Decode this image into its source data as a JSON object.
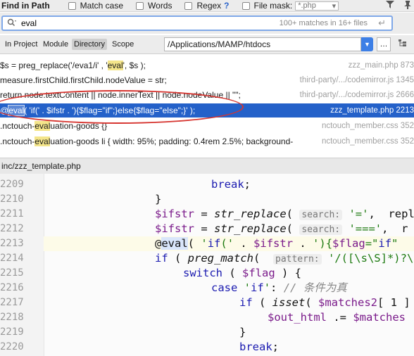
{
  "topbar": {
    "title": "Find in Path",
    "match_case": "Match case",
    "words": "Words",
    "regex": "Regex",
    "regex_help": "?",
    "file_mask_label": "File mask:",
    "file_mask_value": "*.php"
  },
  "search": {
    "query": "eval",
    "matches": "100+ matches in 16+ files"
  },
  "scope": {
    "tabs": [
      "In Project",
      "Module",
      "Directory",
      "Scope"
    ],
    "directory": "/Applications/MAMP/htdocs"
  },
  "results": [
    {
      "code": "",
      "file": ""
    },
    {
      "pre": "$s = preg_replace('/eva1/i' , '",
      "match": "eval",
      "post": "', $s );",
      "file": "zzz_main.php 873"
    },
    {
      "pre": "measure.firstChild.firstChild.nodeValue = str;",
      "match": "",
      "post": "",
      "file": "third-party/.../codemirror.js 1345"
    },
    {
      "pre": "return node.textContent || node.innerText || node.nodeVa",
      "match": "",
      "post": "lue || \"\";",
      "file": "third-party/.../codemirror.js 2666"
    },
    {
      "pre": "@",
      "match": "eval",
      "post": "( 'if(' . $ifstr . '){$flag=\"if\";}else{$flag=\"else\";}' );",
      "file": "zzz_template.php 2213"
    },
    {
      "pre": ".nctouch-",
      "match": "eval",
      "post": "uation-goods {}",
      "file": "nctouch_member.css 352"
    },
    {
      "pre": ".nctouch-",
      "match": "eval",
      "post": "uation-goods li { width: 95%; padding: 0.4rem 2.5%; background-",
      "file": "nctouch_member.css 352"
    }
  ],
  "file_header": "inc/zzz_template.php",
  "editor": {
    "lines": [
      {
        "n": "2209",
        "code": "break;"
      },
      {
        "n": "2210",
        "code": "}"
      },
      {
        "n": "2211",
        "code": "$ifstr = str_replace( search: '=',  repl"
      },
      {
        "n": "2212",
        "code": "$ifstr = str_replace( search: '===',  r"
      },
      {
        "n": "2213",
        "code": "@eval( 'if(' . $ifstr . '){$flag=\"if\""
      },
      {
        "n": "2214",
        "code": "if ( preg_match(  pattern: '/([\\s\\S]*)?\\"
      },
      {
        "n": "2215",
        "code": "switch ( $flag ) {"
      },
      {
        "n": "2216",
        "code": "case 'if': // 条件为真"
      },
      {
        "n": "2217",
        "code": "if ( isset( $matches2[ 1 ]"
      },
      {
        "n": "2218",
        "code": "$out_html .= $matches"
      },
      {
        "n": "2219",
        "code": "}"
      },
      {
        "n": "2220",
        "code": "break;"
      }
    ]
  },
  "colors": {
    "selection": "#2461c9",
    "annotation_circle": "#d6342f",
    "match_highlight": "#f4e58a"
  }
}
